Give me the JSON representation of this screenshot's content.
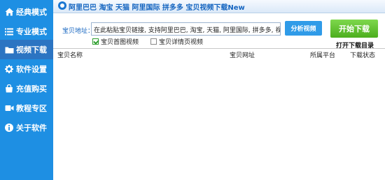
{
  "sidebar": {
    "items": [
      {
        "label": "经典模式",
        "icon": "home-icon",
        "active": false
      },
      {
        "label": "专业模式",
        "icon": "list-icon",
        "active": false
      },
      {
        "label": "视频下载",
        "icon": "folder-icon",
        "active": true
      },
      {
        "label": "软件设置",
        "icon": "gear-icon",
        "active": false
      },
      {
        "label": "充值购买",
        "icon": "shopping-bag-icon",
        "active": false
      },
      {
        "label": "教程专区",
        "icon": "video-camera-icon",
        "active": false
      },
      {
        "label": "关于软件",
        "icon": "info-icon",
        "active": false
      }
    ]
  },
  "banner": {
    "text": "阿里巴巴 淘宝 天猫 阿里国际 拼多多 宝贝视频下载New"
  },
  "form": {
    "address_label": "宝贝地址：",
    "address_value": "在此粘贴宝贝链接, 支持阿里巴巴, 淘宝, 天猫, 阿里国际, 拼多多, 视频下载",
    "analyze_button": "分析视频",
    "start_button": "开始下载",
    "checkbox_main": {
      "label": "宝贝首图视频",
      "checked": true
    },
    "checkbox_detail": {
      "label": "宝贝详情页视频",
      "checked": false
    },
    "open_dir_link": "打开下载目录"
  },
  "table": {
    "columns": [
      "宝贝名称",
      "宝贝网址",
      "所属平台",
      "下载状态"
    ]
  },
  "colors": {
    "sidebar_bg": "#1e8fe3",
    "sidebar_active": "#2c74c2",
    "accent_blue": "#2f9be8",
    "start_green": "#5cbf2a",
    "banner_text": "#1565c0"
  }
}
